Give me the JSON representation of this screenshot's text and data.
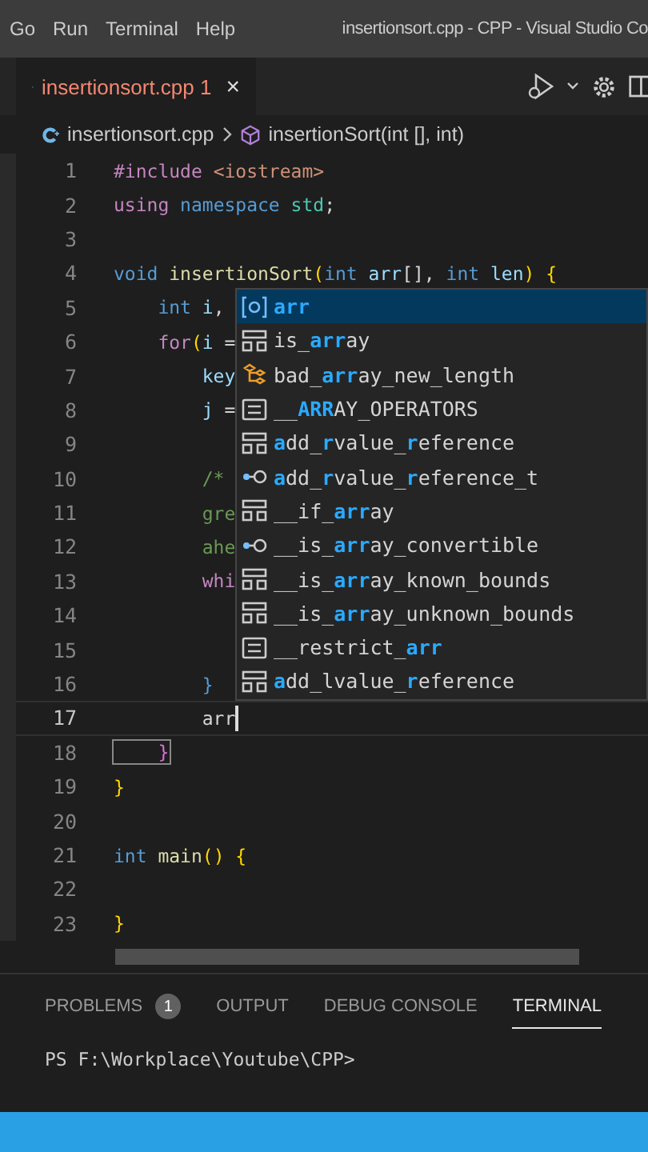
{
  "menu": [
    "Go",
    "Run",
    "Terminal",
    "Help"
  ],
  "window": {
    "title": "insertionsort.cpp - CPP - Visual Studio Co"
  },
  "tab": {
    "label": "insertionsort.cpp 1",
    "has_error": true,
    "close": "×"
  },
  "breadcrumb": {
    "file": "insertionsort.cpp",
    "symbol": "insertionSort(int [], int)"
  },
  "code": [
    {
      "number": "1",
      "current": false,
      "tokens": [
        {
          "kind": "control",
          "text": "#include"
        },
        {
          "kind": "string",
          "text": " <iostream>"
        }
      ]
    },
    {
      "number": "2",
      "current": false,
      "tokens": [
        {
          "kind": "control",
          "text": "using"
        },
        {
          "kind": "keyword",
          "text": " namespace"
        },
        {
          "kind": "type",
          "text": " std"
        },
        {
          "kind": "plain",
          "text": ";"
        }
      ]
    },
    {
      "number": "3",
      "current": false
    },
    {
      "number": "4",
      "current": false,
      "tokens": [
        {
          "kind": "keyword",
          "text": "void"
        },
        {
          "kind": "function",
          "text": " insertionSort"
        },
        {
          "kind": "bracket",
          "text": "("
        },
        {
          "kind": "keyword",
          "text": "int"
        },
        {
          "kind": "variable",
          "text": " arr"
        },
        {
          "kind": "plain",
          "text": "[], "
        },
        {
          "kind": "keyword",
          "text": "int"
        },
        {
          "kind": "variable",
          "text": " len"
        },
        {
          "kind": "bracket",
          "text": ") {"
        }
      ]
    },
    {
      "number": "5",
      "current": false,
      "tokens": [
        {
          "kind": "keyword",
          "text": "    int"
        },
        {
          "kind": "variable",
          "text": " i"
        },
        {
          "kind": "plain",
          "text": ","
        }
      ]
    },
    {
      "number": "6",
      "current": false,
      "tokens": [
        {
          "kind": "control",
          "text": "    for"
        },
        {
          "kind": "bracket",
          "text": "("
        },
        {
          "kind": "variable",
          "text": "i"
        },
        {
          "kind": "plain",
          "text": " ="
        }
      ]
    },
    {
      "number": "7",
      "current": false,
      "tokens": [
        {
          "kind": "variable",
          "text": "        key"
        }
      ]
    },
    {
      "number": "8",
      "current": false,
      "tokens": [
        {
          "kind": "variable",
          "text": "        j"
        },
        {
          "kind": "plain",
          "text": " ="
        }
      ]
    },
    {
      "number": "9",
      "current": false
    },
    {
      "number": "10",
      "current": false,
      "tokens": [
        {
          "kind": "comment",
          "text": "        /*"
        }
      ]
    },
    {
      "number": "11",
      "current": false,
      "tokens": [
        {
          "kind": "comment",
          "text": "        gre"
        }
      ]
    },
    {
      "number": "12",
      "current": false,
      "tokens": [
        {
          "kind": "comment",
          "text": "        ahe"
        }
      ]
    },
    {
      "number": "13",
      "current": false,
      "tokens": [
        {
          "kind": "control",
          "text": "        whi"
        }
      ]
    },
    {
      "number": "14",
      "current": false
    },
    {
      "number": "15",
      "current": false
    },
    {
      "number": "16",
      "current": false,
      "tokens": [
        {
          "kind": "keyword",
          "text": "        }"
        }
      ]
    },
    {
      "number": "17",
      "current": true,
      "tokens": [
        {
          "kind": "plain",
          "text": "        arr"
        }
      ]
    },
    {
      "number": "18",
      "current": false,
      "tokens": [
        {
          "kind": "matched",
          "text": "    }"
        }
      ]
    },
    {
      "number": "19",
      "current": false,
      "tokens": [
        {
          "kind": "bracket",
          "text": "}"
        }
      ]
    },
    {
      "number": "20",
      "current": false
    },
    {
      "number": "21",
      "current": false,
      "tokens": [
        {
          "kind": "keyword",
          "text": "int"
        },
        {
          "kind": "function",
          "text": " main"
        },
        {
          "kind": "bracket",
          "text": "() {"
        }
      ]
    },
    {
      "number": "22",
      "current": false
    },
    {
      "number": "23",
      "current": false,
      "tokens": [
        {
          "kind": "bracket",
          "text": "}"
        }
      ]
    }
  ],
  "suggestions": [
    {
      "kind": "variable",
      "selected": true,
      "parts": [
        {
          "text": "arr",
          "match": true
        }
      ]
    },
    {
      "kind": "struct",
      "selected": false,
      "parts": [
        {
          "text": "is_",
          "match": false
        },
        {
          "text": "arr",
          "match": true
        },
        {
          "text": "ay",
          "match": false
        }
      ]
    },
    {
      "kind": "class",
      "selected": false,
      "parts": [
        {
          "text": "bad_",
          "match": false
        },
        {
          "text": "arr",
          "match": true
        },
        {
          "text": "ay_new_length",
          "match": false
        }
      ]
    },
    {
      "kind": "constant",
      "selected": false,
      "parts": [
        {
          "text": "__",
          "match": false
        },
        {
          "text": "ARR",
          "match": true
        },
        {
          "text": "AY_OPERATORS",
          "match": false
        }
      ]
    },
    {
      "kind": "struct",
      "selected": false,
      "parts": [
        {
          "text": "a",
          "match": true
        },
        {
          "text": "dd_",
          "match": false
        },
        {
          "text": "r",
          "match": true
        },
        {
          "text": "value_",
          "match": false
        },
        {
          "text": "r",
          "match": true
        },
        {
          "text": "eference",
          "match": false
        }
      ]
    },
    {
      "kind": "typedef",
      "selected": false,
      "parts": [
        {
          "text": "a",
          "match": true
        },
        {
          "text": "dd_",
          "match": false
        },
        {
          "text": "r",
          "match": true
        },
        {
          "text": "value_",
          "match": false
        },
        {
          "text": "r",
          "match": true
        },
        {
          "text": "eference_t",
          "match": false
        }
      ]
    },
    {
      "kind": "struct",
      "selected": false,
      "parts": [
        {
          "text": "__if_",
          "match": false
        },
        {
          "text": "arr",
          "match": true
        },
        {
          "text": "ay",
          "match": false
        }
      ]
    },
    {
      "kind": "typedef",
      "selected": false,
      "parts": [
        {
          "text": "__is_",
          "match": false
        },
        {
          "text": "arr",
          "match": true
        },
        {
          "text": "ay_convertible",
          "match": false
        }
      ]
    },
    {
      "kind": "struct",
      "selected": false,
      "parts": [
        {
          "text": "__is_",
          "match": false
        },
        {
          "text": "arr",
          "match": true
        },
        {
          "text": "ay_known_bounds",
          "match": false
        }
      ]
    },
    {
      "kind": "struct",
      "selected": false,
      "parts": [
        {
          "text": "__is_",
          "match": false
        },
        {
          "text": "arr",
          "match": true
        },
        {
          "text": "ay_unknown_bounds",
          "match": false
        }
      ]
    },
    {
      "kind": "constant",
      "selected": false,
      "parts": [
        {
          "text": "__restrict_",
          "match": false
        },
        {
          "text": "arr",
          "match": true
        }
      ]
    },
    {
      "kind": "struct",
      "selected": false,
      "parts": [
        {
          "text": "a",
          "match": true
        },
        {
          "text": "dd_",
          "match": false
        },
        {
          "text": "l",
          "match": false
        },
        {
          "text": "value_",
          "match": false
        },
        {
          "text": "r",
          "match": true
        },
        {
          "text": "eference",
          "match": false
        }
      ]
    }
  ],
  "panel": {
    "tabs": [
      {
        "label": "PROBLEMS",
        "badge": "1",
        "selected": false
      },
      {
        "label": "OUTPUT",
        "selected": false
      },
      {
        "label": "DEBUG CONSOLE",
        "selected": false
      },
      {
        "label": "TERMINAL",
        "selected": true
      }
    ],
    "terminal": "PS F:\\Workplace\\Youtube\\CPP>"
  }
}
